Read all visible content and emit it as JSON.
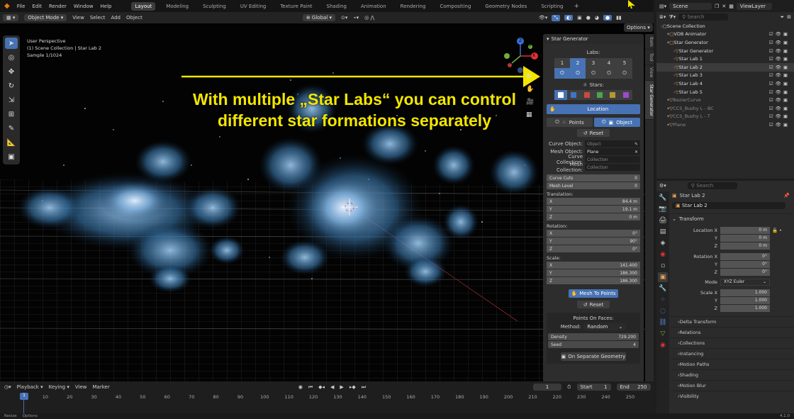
{
  "topbar": {
    "menus": [
      "File",
      "Edit",
      "Render",
      "Window",
      "Help"
    ],
    "workspaces": [
      "Layout",
      "Modeling",
      "Sculpting",
      "UV Editing",
      "Texture Paint",
      "Shading",
      "Animation",
      "Rendering",
      "Compositing",
      "Geometry Nodes",
      "Scripting"
    ],
    "active_workspace": "Layout",
    "add_tab": "+",
    "scene_label": "Scene",
    "viewlayer_label": "ViewLayer"
  },
  "header": {
    "mode": "Object Mode",
    "menus": [
      "View",
      "Select",
      "Add",
      "Object"
    ],
    "transform_orientation": "Global",
    "options": "Options"
  },
  "viewport": {
    "perspective": "User Perspective",
    "collection_path": "(1) Scene Collection | Star Lab 2",
    "sample": "Sample 1/1024",
    "annotation_line1": "With multiple „Star Labs“ you can control",
    "annotation_line2": "different star formations separately",
    "accent_yellow": "#f2e600",
    "gizmo": {
      "x": "X",
      "y": "Y",
      "z": "Z"
    }
  },
  "star_panel": {
    "title": "Star Generator",
    "labs_label": "Labs:",
    "labs": [
      "1",
      "2",
      "3",
      "4",
      "5"
    ],
    "active_lab": "2",
    "stars_label": "Stars:",
    "star_colors": [
      "#ffffff",
      "#3f74c9",
      "#c94a3f",
      "#4aa64a",
      "#b49a2e",
      "#9b4bc9"
    ],
    "location_button": "Location",
    "points_label": "Points",
    "object_label": "Object",
    "reset_label": "Reset",
    "curve_object_label": "Curve Object:",
    "curve_object_value": "Object",
    "mesh_object_label": "Mesh Object:",
    "mesh_object_value": "Plane",
    "curve_collection_label": "Curve Collection:",
    "curve_collection_value": "Collection",
    "mesh_collection_label": "Mesh Collection:",
    "mesh_collection_value": "Collection",
    "curve_cuts_label": "Curve Cuts",
    "curve_cuts_value": "0",
    "mesh_level_label": "Mesh Level",
    "mesh_level_value": "0",
    "translation_label": "Translation:",
    "translation": [
      {
        "axis": "X",
        "value": "84.4 m"
      },
      {
        "axis": "Y",
        "value": "19.1 m"
      },
      {
        "axis": "Z",
        "value": "0 m"
      }
    ],
    "rotation_label": "Rotation:",
    "rotation": [
      {
        "axis": "X",
        "value": "0°"
      },
      {
        "axis": "Y",
        "value": "90°"
      },
      {
        "axis": "Z",
        "value": "0°"
      }
    ],
    "scale_label": "Scale:",
    "scale": [
      {
        "axis": "X",
        "value": "141.400"
      },
      {
        "axis": "Y",
        "value": "186.300"
      },
      {
        "axis": "Z",
        "value": "186.300"
      }
    ],
    "mesh_to_points": "Mesh To Points",
    "reset2": "Reset",
    "points_on_faces": "Points On Faces:",
    "method_label": "Method:",
    "method_value": "Random",
    "density_label": "Density",
    "density_value": "729.200",
    "seed_label": "Seed",
    "seed_value": "4",
    "on_separate_geometry": "On Separate Geometry"
  },
  "side_tabs": [
    "Item",
    "Tool",
    "View",
    "Star Generator"
  ],
  "outliner": {
    "search_placeholder": "Search",
    "rows": [
      {
        "name": "Scene Collection",
        "indent": 0,
        "dim": false
      },
      {
        "name": "VDB Animator",
        "indent": 1,
        "dim": false
      },
      {
        "name": "Star Generator",
        "indent": 1,
        "dim": false
      },
      {
        "name": "Star Generator",
        "indent": 2,
        "dim": false
      },
      {
        "name": "Star Lab 1",
        "indent": 2,
        "dim": false
      },
      {
        "name": "Star Lab 2",
        "indent": 2,
        "dim": false
      },
      {
        "name": "Star Lab 3",
        "indent": 2,
        "dim": false
      },
      {
        "name": "Star Lab 4",
        "indent": 2,
        "dim": false
      },
      {
        "name": "Star Lab 5",
        "indent": 2,
        "dim": false
      },
      {
        "name": "BezierCurve",
        "indent": 1,
        "dim": true
      },
      {
        "name": "CCS_Bushy L - BC",
        "indent": 1,
        "dim": true
      },
      {
        "name": "CCS_Bushy L - T",
        "indent": 1,
        "dim": true
      },
      {
        "name": "Plane",
        "indent": 1,
        "dim": true
      }
    ]
  },
  "properties": {
    "search_placeholder": "Search",
    "object_name": "Star Lab 2",
    "object_field": "Star Lab 2",
    "transform_label": "Transform",
    "location_label": "Location X",
    "location": [
      "0 m",
      "0 m",
      "0 m"
    ],
    "rotation_label": "Rotation X",
    "rotation": [
      "0°",
      "0°",
      "0°"
    ],
    "mode_label": "Mode",
    "mode_value": "XYZ Euler",
    "scale_label": "Scale X",
    "scale": [
      "1.000",
      "1.000",
      "1.000"
    ],
    "axis_y": "Y",
    "axis_z": "Z",
    "sections": [
      "Delta Transform",
      "Relations",
      "Collections",
      "Instancing",
      "Motion Paths",
      "Shading",
      "Motion Blur",
      "Visibility"
    ]
  },
  "timeline": {
    "menus": [
      "Playback",
      "Keying",
      "View",
      "Marker"
    ],
    "current_frame": "1",
    "start_label": "Start",
    "start_value": "1",
    "end_label": "End",
    "end_value": "250",
    "ticks": [
      "10",
      "20",
      "30",
      "40",
      "50",
      "60",
      "70",
      "80",
      "90",
      "100",
      "110",
      "120",
      "130",
      "140",
      "150",
      "160",
      "170",
      "180",
      "190",
      "200",
      "210",
      "220",
      "230",
      "240",
      "250"
    ],
    "playhead": "1"
  },
  "statusbar": {
    "left": "Resize",
    "right": "Options",
    "version": "4.1.0"
  }
}
